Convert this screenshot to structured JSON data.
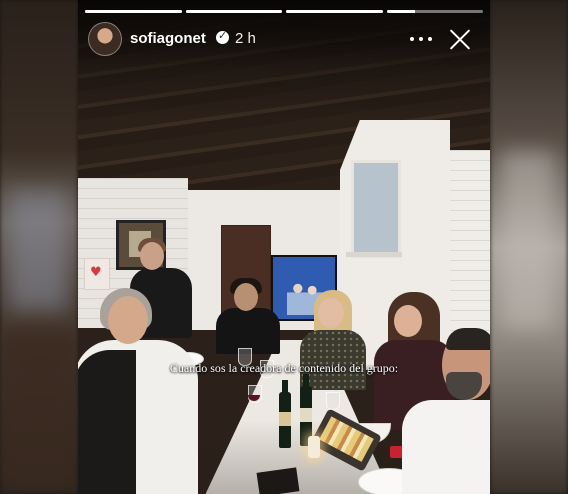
{
  "story": {
    "username": "sofiagonet",
    "verified": true,
    "time_ago": "2 h",
    "caption": "Cuando sos la creadora de contenido del grupo:",
    "progress": [
      1,
      1,
      1,
      0.3
    ],
    "icons": {
      "avatar": "profile-avatar",
      "verified": "verified-badge-icon",
      "more": "more-options-icon",
      "close": "close-icon"
    }
  }
}
